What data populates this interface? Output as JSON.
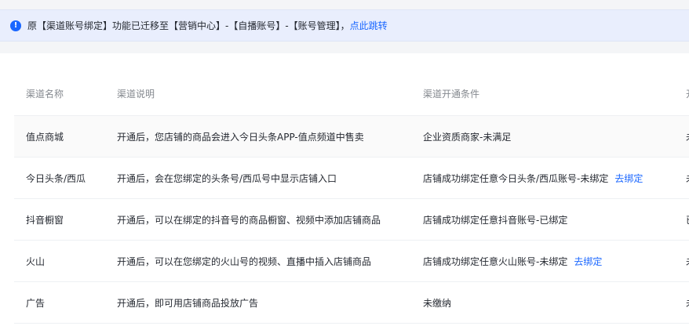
{
  "notice": {
    "icon": "exclamation-circle-icon",
    "text": "原【渠道账号绑定】功能已迁移至【营销中心】-【自播账号】-【账号管理】，",
    "link": "点此跳转"
  },
  "table": {
    "headers": [
      "渠道名称",
      "渠道说明",
      "渠道开通条件",
      "开"
    ],
    "rows": [
      {
        "name": "值点商城",
        "desc": "开通后，您店铺的商品会进入今日头条APP-值点频道中售卖",
        "cond": "企业资质商家-未满足",
        "action": "",
        "status": "未"
      },
      {
        "name": "今日头条/西瓜",
        "desc": "开通后，会在您绑定的头条号/西瓜号中显示店铺入口",
        "cond": "店铺成功绑定任意今日头条/西瓜账号-未绑定",
        "action": "去绑定",
        "status": "未"
      },
      {
        "name": "抖音橱窗",
        "desc": "开通后，可以在绑定的抖音号的商品橱窗、视频中添加店铺商品",
        "cond": "店铺成功绑定任意抖音账号-已绑定",
        "action": "",
        "status": "已"
      },
      {
        "name": "火山",
        "desc": "开通后，可以在您绑定的火山号的视频、直播中插入店铺商品",
        "cond": "店铺成功绑定任意火山账号-未绑定",
        "action": "去绑定",
        "status": "未"
      },
      {
        "name": "广告",
        "desc": "开通后，即可用店铺商品投放广告",
        "cond": "未缴纳",
        "action": "",
        "status": "未"
      }
    ]
  },
  "colors": {
    "accent": "#1966ff",
    "notice_bg": "#e9eefd",
    "header_text": "#85898f"
  }
}
